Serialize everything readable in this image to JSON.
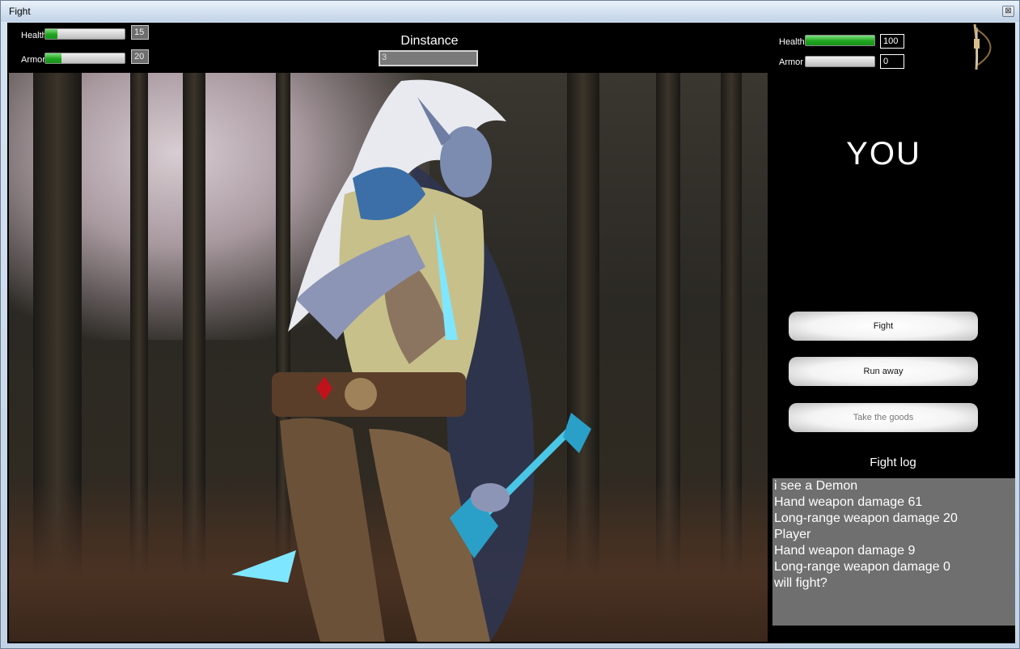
{
  "window": {
    "title": "Fight",
    "close_glyph": "⊠"
  },
  "enemy": {
    "health_label": "Health",
    "health_value": "15",
    "health_fill": 0.15,
    "armor_label": "Armor",
    "armor_value": "20",
    "armor_fill": 0.2
  },
  "distance": {
    "title": "Dinstance",
    "value": "3"
  },
  "player": {
    "health_label": "Health",
    "health_value": "100",
    "health_fill": 1.0,
    "armor_label": "Armor",
    "armor_value": "0",
    "armor_fill": 0.0,
    "name_label": "YOU"
  },
  "actions": {
    "fight": "Fight",
    "run_away": "Run away",
    "take_goods": "Take the goods"
  },
  "log": {
    "title": "Fight log",
    "lines": [
      "i see a Demon",
      "Hand weapon damage 61",
      "Long-range weapon damage 20",
      "Player",
      "Hand weapon damage 9",
      "Long-range weapon damage 0",
      "will fight?"
    ]
  },
  "colors": {
    "health_fill": "#1fa51f",
    "log_bg": "#6f6f6f",
    "panel_bg": "#000000"
  },
  "icons": {
    "weapon": "bow-icon"
  }
}
